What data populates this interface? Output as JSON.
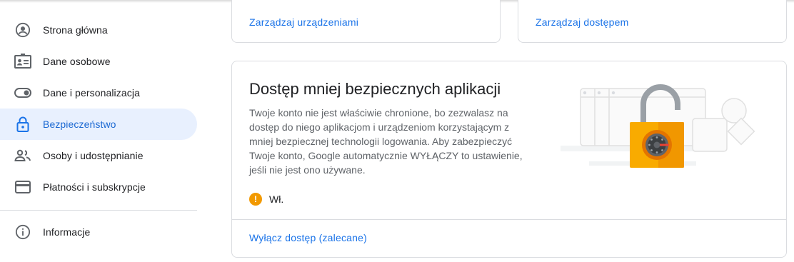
{
  "sidebar": {
    "items": [
      {
        "label": "Strona główna",
        "icon": "account-circle-icon"
      },
      {
        "label": "Dane osobowe",
        "icon": "id-card-icon"
      },
      {
        "label": "Dane i personalizacja",
        "icon": "toggle-icon"
      },
      {
        "label": "Bezpieczeństwo",
        "icon": "lock-icon",
        "active": true
      },
      {
        "label": "Osoby i udostępnianie",
        "icon": "people-icon"
      },
      {
        "label": "Płatności i subskrypcje",
        "icon": "credit-card-icon"
      }
    ],
    "info": {
      "label": "Informacje",
      "icon": "info-icon"
    }
  },
  "cards": {
    "devices_link": "Zarządzaj urządzeniami",
    "access_link": "Zarządzaj dostępem"
  },
  "less_secure": {
    "title": "Dostęp mniej bezpiecznych aplikacji",
    "description": "Twoje konto nie jest właściwie chronione, bo zezwalasz na dostęp do niego aplikacjom i urządzeniom korzystającym z mniej bezpiecznej technologii logowania. Aby zabezpieczyć Twoje konto, Google automatycznie WYŁĄCZY to ustawienie, jeśli nie jest ono używane.",
    "status_icon": "!",
    "status_text": "Wł.",
    "action_link": "Wyłącz dostęp (zalecane)"
  },
  "colors": {
    "accent": "#1a73e8",
    "active_bg": "#e8f0fe",
    "warning": "#f29900",
    "lock_body": "#f9ab00"
  }
}
